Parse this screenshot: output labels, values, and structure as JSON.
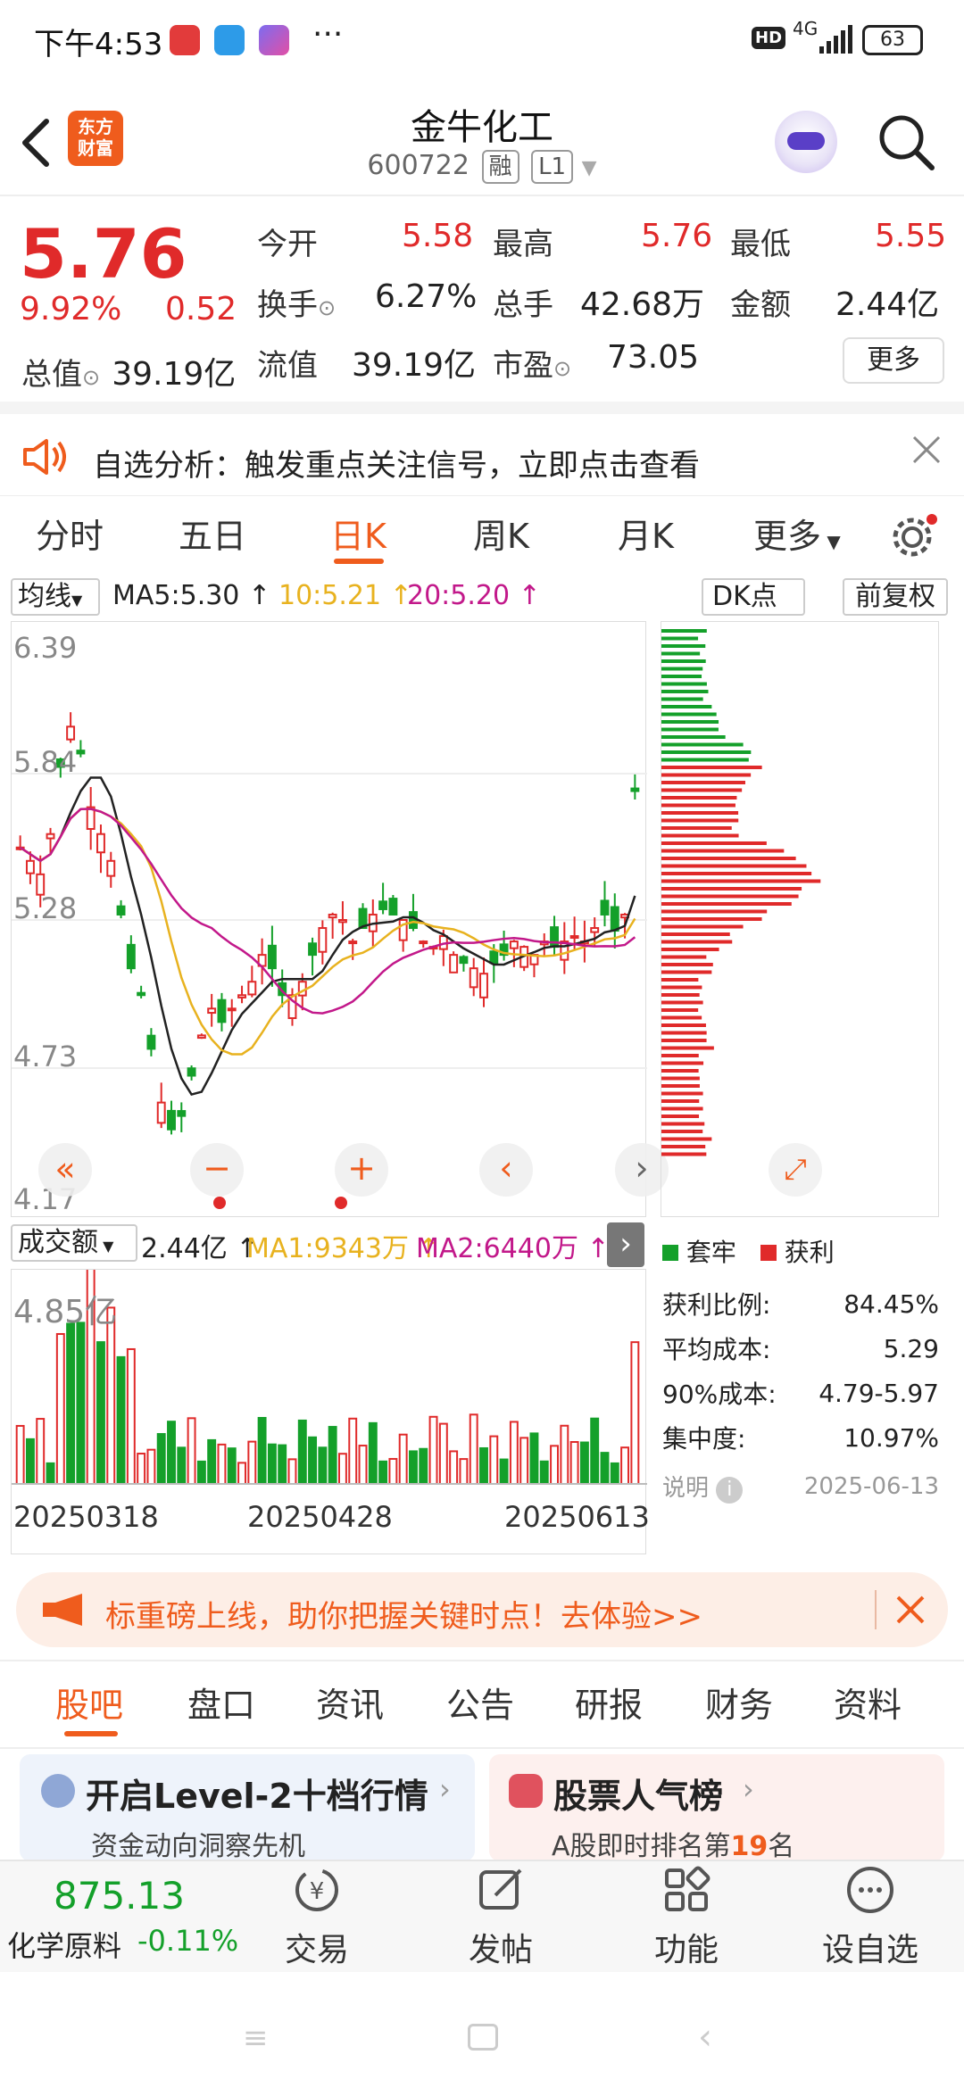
{
  "status_bar": {
    "time": "下午4:53",
    "dots": "···",
    "hd": "HD",
    "net": "4G",
    "battery": "63"
  },
  "header": {
    "logo_text": "东方\n财富",
    "title": "金牛化工",
    "code": "600722",
    "tag1": "融",
    "tag2": "L1"
  },
  "quote": {
    "price": "5.76",
    "change_pct": "9.92%",
    "change": "0.52",
    "stats": [
      {
        "label": "今开",
        "value": "5.58"
      },
      {
        "label": "最高",
        "value": "5.76"
      },
      {
        "label": "最低",
        "value": "5.55"
      },
      {
        "label": "换手",
        "value": "6.27%"
      },
      {
        "label": "总手",
        "value": "42.68万"
      },
      {
        "label": "金额",
        "value": "2.44亿"
      },
      {
        "label": "总值",
        "value": "39.19亿"
      },
      {
        "label": "流值",
        "value": "39.19亿"
      },
      {
        "label": "市盈",
        "value": "73.05"
      }
    ],
    "more_btn": "更多"
  },
  "notice": {
    "text": "自选分析：触发重点关注信号，立即点击查看"
  },
  "ktabs": [
    "分时",
    "五日",
    "日K",
    "周K",
    "月K",
    "更多"
  ],
  "ma_bar": {
    "selector": "均线",
    "ma5": "MA5:5.30",
    "ma10": "10:5.21",
    "ma20": "20:5.20",
    "dk": "DK点",
    "adjust": "前复权"
  },
  "price_axis": [
    "6.39",
    "5.84",
    "5.28",
    "4.73",
    "4.17"
  ],
  "vol_bar": {
    "selector": "成交额",
    "value": "2.44亿",
    "ma1": "MA1:9343万",
    "ma2": "MA2:6440万",
    "max": "4.85亿"
  },
  "dates": [
    "20250318",
    "20250428",
    "20250613"
  ],
  "chips": {
    "legend_trap": "套牢",
    "legend_profit": "获利",
    "rows": [
      {
        "label": "获利比例:",
        "value": "84.45%"
      },
      {
        "label": "平均成本:",
        "value": "5.29"
      },
      {
        "label": "90%成本:",
        "value": "4.79-5.97"
      },
      {
        "label": "集中度:",
        "value": "10.97%"
      }
    ],
    "note": "说明",
    "date": "2025-06-13"
  },
  "banner": {
    "text": "标重磅上线，助你把握关键时点！去体验>>"
  },
  "sub_tabs": [
    "股吧",
    "盘口",
    "资讯",
    "公告",
    "研报",
    "财务",
    "资料"
  ],
  "cards": [
    {
      "title": "开启Level-2十档行情",
      "sub": "资金动向洞察先机"
    },
    {
      "title": "股票人气榜",
      "sub_pre": "A股即时排名第",
      "rank": "19",
      "sub_post": "名"
    }
  ],
  "bottom": {
    "index_value": "875.13",
    "index_name": "化学原料",
    "index_change": "-0.11%",
    "items": [
      "交易",
      "发帖",
      "功能",
      "设自选"
    ]
  },
  "colors": {
    "up": "#e02a2a",
    "down": "#14a02a",
    "accent": "#ef5c1d",
    "ma10": "#e8b21f",
    "ma20": "#c2188a"
  }
}
